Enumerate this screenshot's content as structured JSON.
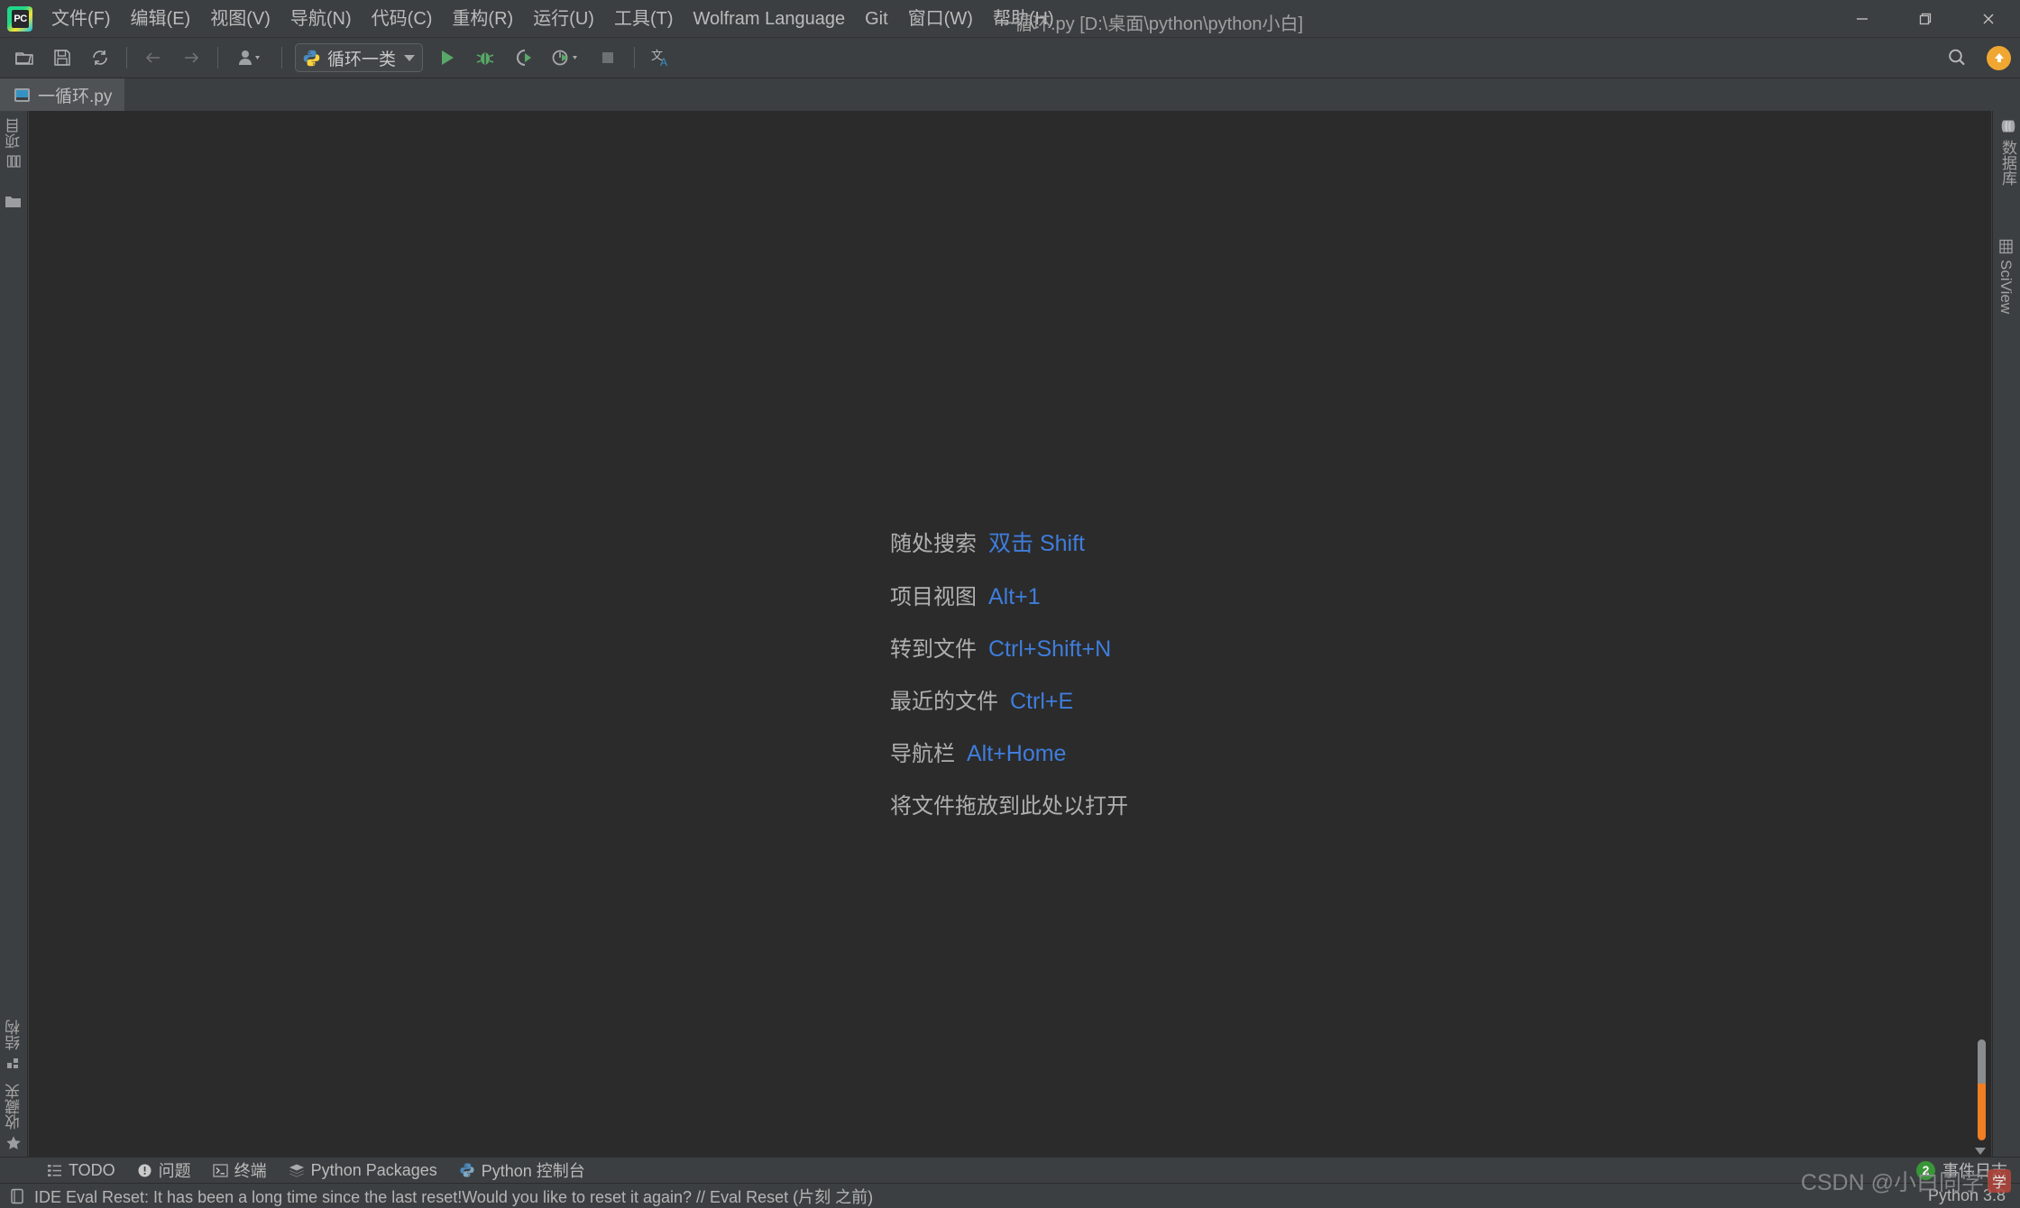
{
  "window": {
    "title": "一循环.py [D:\\桌面\\python\\python小白]",
    "app_logo_text": "PC",
    "controls": {
      "minimize": "—",
      "restore": "❐",
      "close": "✕"
    }
  },
  "menubar": {
    "items": [
      {
        "label": "文件(F)",
        "name": "menu-file"
      },
      {
        "label": "编辑(E)",
        "name": "menu-edit"
      },
      {
        "label": "视图(V)",
        "name": "menu-view"
      },
      {
        "label": "导航(N)",
        "name": "menu-navigate"
      },
      {
        "label": "代码(C)",
        "name": "menu-code"
      },
      {
        "label": "重构(R)",
        "name": "menu-refactor"
      },
      {
        "label": "运行(U)",
        "name": "menu-run"
      },
      {
        "label": "工具(T)",
        "name": "menu-tools"
      },
      {
        "label": "Wolfram Language",
        "name": "menu-wolfram-language"
      },
      {
        "label": "Git",
        "name": "menu-git"
      },
      {
        "label": "窗口(W)",
        "name": "menu-window"
      },
      {
        "label": "帮助(H)",
        "name": "menu-help"
      }
    ]
  },
  "toolbar": {
    "icons": [
      {
        "name": "open-folder-icon",
        "title": "打开"
      },
      {
        "name": "save-icon",
        "title": "保存"
      },
      {
        "name": "sync-icon",
        "title": "同步"
      },
      {
        "name": "back-arrow-icon",
        "title": "后退"
      },
      {
        "name": "forward-arrow-icon",
        "title": "前进"
      },
      {
        "name": "profile-user-icon",
        "title": "用户"
      }
    ],
    "run_configuration": {
      "label": "循环一类",
      "icon": "python-icon"
    },
    "run_label": "运行",
    "debug_label": "调试",
    "coverage_label": "运行覆盖率",
    "profile_label": "性能分析",
    "stop_label": "停止",
    "translate_label": "翻译",
    "search_label": "搜索",
    "update_label": "更新"
  },
  "editor_tabs": [
    {
      "label": "一循环.py",
      "icon": "python-file-icon",
      "active": true
    }
  ],
  "left_stripe": {
    "top": [
      {
        "label": "项目",
        "name": "tool-window-project",
        "icon": "project-icon"
      },
      {
        "label": "",
        "name": "tool-window-folder",
        "icon": "folder-icon"
      }
    ],
    "bottom": [
      {
        "label": "结构",
        "name": "tool-window-structure",
        "icon": "structure-icon"
      },
      {
        "label": "收藏夹",
        "name": "tool-window-favorites",
        "icon": "star-icon"
      }
    ]
  },
  "right_stripe": {
    "items": [
      {
        "label": "数据库",
        "name": "tool-window-database",
        "icon": "database-icon"
      },
      {
        "label": "SciView",
        "name": "tool-window-sciview",
        "icon": "grid-icon"
      }
    ]
  },
  "editor": {
    "hints": [
      {
        "desc": "随处搜索",
        "key": "双击 Shift"
      },
      {
        "desc": "项目视图",
        "key": "Alt+1"
      },
      {
        "desc": "转到文件",
        "key": "Ctrl+Shift+N"
      },
      {
        "desc": "最近的文件",
        "key": "Ctrl+E"
      },
      {
        "desc": "导航栏",
        "key": "Alt+Home"
      }
    ],
    "drop_hint": "将文件拖放到此处以打开"
  },
  "bottom_bar": {
    "items": [
      {
        "label": "TODO",
        "name": "tool-window-todo",
        "icon": "list-icon"
      },
      {
        "label": "问题",
        "name": "tool-window-problems",
        "icon": "warning-icon"
      },
      {
        "label": "终端",
        "name": "tool-window-terminal",
        "icon": "terminal-icon"
      },
      {
        "label": "Python Packages",
        "name": "tool-window-python-packages",
        "icon": "layers-icon"
      },
      {
        "label": "Python 控制台",
        "name": "tool-window-python-console",
        "icon": "python-icon"
      }
    ],
    "event_log": {
      "label": "事件日志",
      "count": "2"
    }
  },
  "status_bar": {
    "message": "IDE Eval Reset: It has been a long time since the last reset!Would you like to reset it again? // Eval Reset (片刻 之前)",
    "interpreter": "Python 3.8"
  },
  "watermark": {
    "text": "CSDN @小白同学",
    "seal": "学"
  },
  "colors": {
    "chrome": "#3c3f41",
    "editor_bg": "#2b2b2b",
    "accent_blue": "#3f7ddc",
    "accent_orange": "#f0a732",
    "badge_green": "#389638",
    "text": "#bbbbbb"
  }
}
